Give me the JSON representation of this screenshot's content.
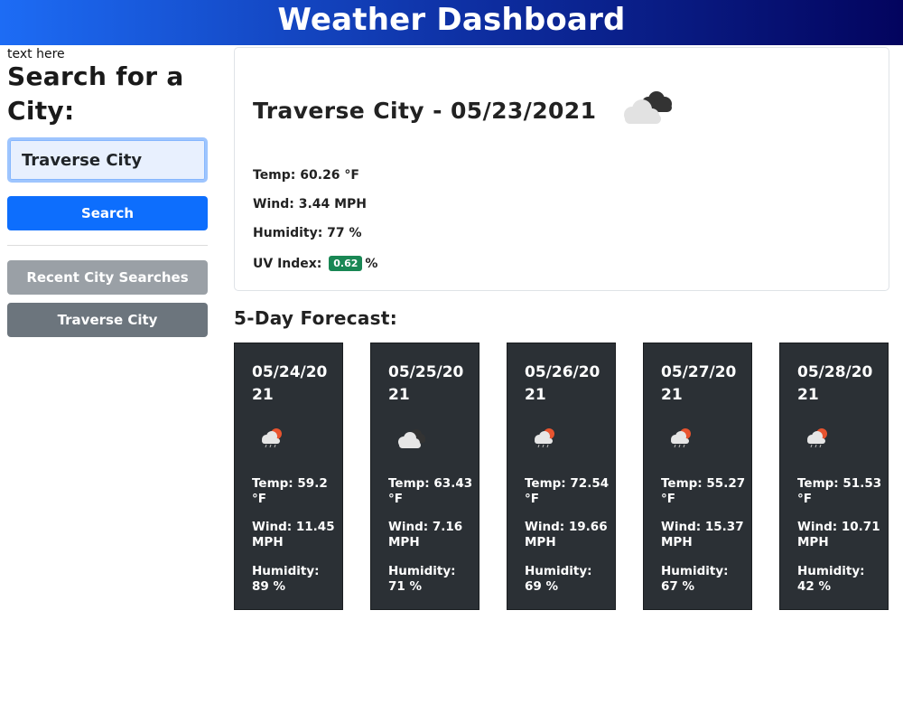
{
  "header": {
    "title": "Weather Dashboard"
  },
  "sidebar": {
    "tiny_text": "text here",
    "heading": "Search for a City:",
    "input_value": "Traverse City",
    "search_label": "Search",
    "recent_label": "Recent City Searches",
    "history": [
      "Traverse City"
    ]
  },
  "current": {
    "title": "Traverse City - 05/23/2021",
    "icon": "cloudy-icon",
    "temp": "Temp: 60.26 °F",
    "wind": "Wind: 3.44 MPH",
    "humidity": "Humidity: 77 %",
    "uv_label": "UV Index:",
    "uv_value": "0.62",
    "uv_unit": "%",
    "uv_color": "#198754"
  },
  "forecast": {
    "heading": "5-Day Forecast:",
    "days": [
      {
        "date": "05/24/2021",
        "icon": "rain-sun-icon",
        "temp": "Temp: 59.2 °F",
        "wind": "Wind: 11.45 MPH",
        "humidity": "Humidity: 89 %"
      },
      {
        "date": "05/25/2021",
        "icon": "cloudy-icon",
        "temp": "Temp: 63.43 °F",
        "wind": "Wind: 7.16 MPH",
        "humidity": "Humidity: 71 %"
      },
      {
        "date": "05/26/2021",
        "icon": "rain-sun-icon",
        "temp": "Temp: 72.54 °F",
        "wind": "Wind: 19.66 MPH",
        "humidity": "Humidity: 69 %"
      },
      {
        "date": "05/27/2021",
        "icon": "rain-sun-icon",
        "temp": "Temp: 55.27 °F",
        "wind": "Wind: 15.37 MPH",
        "humidity": "Humidity: 67 %"
      },
      {
        "date": "05/28/2021",
        "icon": "rain-sun-icon",
        "temp": "Temp: 51.53 °F",
        "wind": "Wind: 10.71 MPH",
        "humidity": "Humidity: 42 %"
      }
    ]
  },
  "colors": {
    "header_start": "#1d6cf5",
    "header_end": "#03045e",
    "primary": "#0d6efd",
    "secondary": "#6c757d",
    "card_dark": "#2b3035"
  }
}
